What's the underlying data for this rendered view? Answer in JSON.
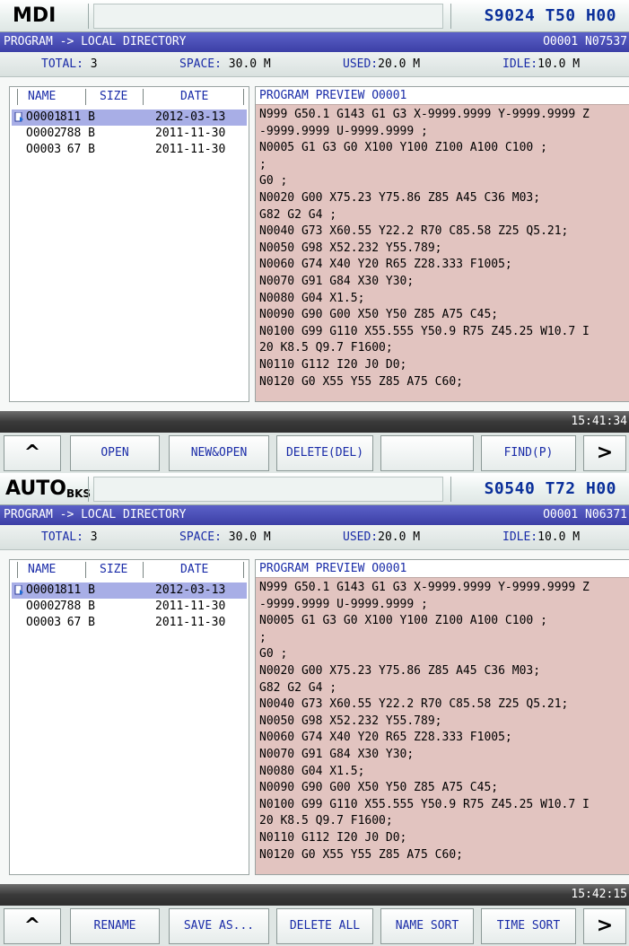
{
  "screens": [
    {
      "mode": "MDI",
      "mode_sub": "",
      "spindle": "S9024",
      "tool": "T50",
      "h": "H00",
      "path": "PROGRAM -> LOCAL DIRECTORY",
      "prog_id": "O0001 N07537",
      "stats": {
        "total_label": "TOTAL:",
        "total_value": "3",
        "space_label": "SPACE:",
        "space_value": "30.0 M",
        "used_label": "USED:",
        "used_value": "20.0 M",
        "idle_label": "IDLE:",
        "idle_value": "10.0 M"
      },
      "columns": {
        "name": "NAME",
        "size": "SIZE",
        "date": "DATE"
      },
      "files": [
        {
          "name": "O0001",
          "size": "811 B",
          "date": "2012-03-13",
          "selected": true
        },
        {
          "name": "O0002",
          "size": "788 B",
          "date": "2011-11-30",
          "selected": false
        },
        {
          "name": "O0003",
          "size": "67 B",
          "date": "2011-11-30",
          "selected": false
        }
      ],
      "preview_title": "PROGRAM PREVIEW O0001",
      "preview_lines": [
        "N999 G50.1 G143 G1 G3 X-9999.9999 Y-9999.9999 Z",
        "-9999.9999 U-9999.9999 ;",
        "N0005 G1 G3 G0 X100 Y100 Z100 A100 C100 ;",
        ";",
        "G0 ;",
        "N0020 G00 X75.23 Y75.86 Z85 A45 C36 M03;",
        "G82 G2 G4 ;",
        "N0040 G73 X60.55 Y22.2 R70 C85.58 Z25 Q5.21;",
        "N0050 G98 X52.232 Y55.789;",
        "N0060 G74 X40 Y20 R65 Z28.333 F1005;",
        "N0070 G91 G84 X30 Y30;",
        "N0080 G04 X1.5;",
        "N0090 G90 G00 X50 Y50 Z85 A75 C45;",
        "N0100 G99 G110 X55.555 Y50.9 R75 Z45.25 W10.7 I",
        "20 K8.5 Q9.7 F1600;",
        "N0110 G112 I20 J0 D0;",
        "N0120 G0 X55 Y55 Z85 A75 C60;"
      ],
      "time": "15:41:34",
      "softkeys": [
        "^",
        "OPEN",
        "NEW&OPEN",
        "DELETE(DEL)",
        "",
        "FIND(P)",
        ">"
      ]
    },
    {
      "mode": "AUTO",
      "mode_sub": "BKS",
      "spindle": "S0540",
      "tool": "T72",
      "h": "H00",
      "path": "PROGRAM -> LOCAL DIRECTORY",
      "prog_id": "O0001 N06371",
      "stats": {
        "total_label": "TOTAL:",
        "total_value": "3",
        "space_label": "SPACE:",
        "space_value": "30.0 M",
        "used_label": "USED:",
        "used_value": "20.0 M",
        "idle_label": "IDLE:",
        "idle_value": "10.0 M"
      },
      "columns": {
        "name": "NAME",
        "size": "SIZE",
        "date": "DATE"
      },
      "files": [
        {
          "name": "O0001",
          "size": "811 B",
          "date": "2012-03-13",
          "selected": true
        },
        {
          "name": "O0002",
          "size": "788 B",
          "date": "2011-11-30",
          "selected": false
        },
        {
          "name": "O0003",
          "size": "67 B",
          "date": "2011-11-30",
          "selected": false
        }
      ],
      "preview_title": "PROGRAM PREVIEW O0001",
      "preview_lines": [
        "N999 G50.1 G143 G1 G3 X-9999.9999 Y-9999.9999 Z",
        "-9999.9999 U-9999.9999 ;",
        "N0005 G1 G3 G0 X100 Y100 Z100 A100 C100 ;",
        ";",
        "G0 ;",
        "N0020 G00 X75.23 Y75.86 Z85 A45 C36 M03;",
        "G82 G2 G4 ;",
        "N0040 G73 X60.55 Y22.2 R70 C85.58 Z25 Q5.21;",
        "N0050 G98 X52.232 Y55.789;",
        "N0060 G74 X40 Y20 R65 Z28.333 F1005;",
        "N0070 G91 G84 X30 Y30;",
        "N0080 G04 X1.5;",
        "N0090 G90 G00 X50 Y50 Z85 A75 C45;",
        "N0100 G99 G110 X55.555 Y50.9 R75 Z45.25 W10.7 I",
        "20 K8.5 Q9.7 F1600;",
        "N0110 G112 I20 J0 D0;",
        "N0120 G0 X55 Y55 Z85 A75 C60;"
      ],
      "time": "15:42:15",
      "softkeys": [
        "^",
        "RENAME",
        "SAVE AS...",
        "DELETE ALL",
        "NAME SORT",
        "TIME SORT",
        ">"
      ]
    }
  ]
}
